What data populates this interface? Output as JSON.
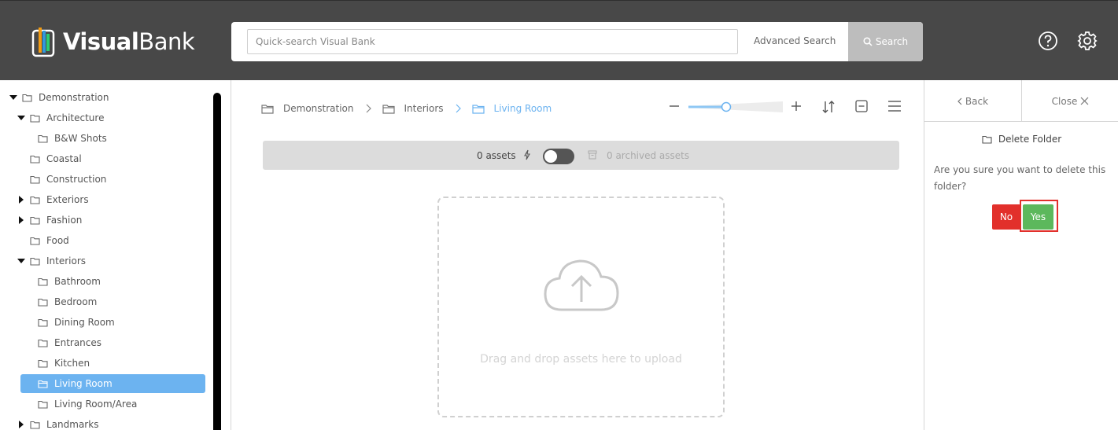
{
  "header": {
    "logo_text_bold": "Visual",
    "logo_text_light": "Bank",
    "search_placeholder": "Quick-search Visual Bank",
    "advanced_search": "Advanced Search",
    "search_button": "Search"
  },
  "tree": {
    "items": [
      {
        "label": "Demonstration",
        "expanded": true
      },
      {
        "label": "Architecture",
        "expanded": true
      },
      {
        "label": "B&W Shots"
      },
      {
        "label": "Coastal"
      },
      {
        "label": "Construction"
      },
      {
        "label": "Exteriors",
        "expanded": false
      },
      {
        "label": "Fashion",
        "expanded": false
      },
      {
        "label": "Food"
      },
      {
        "label": "Interiors",
        "expanded": true
      },
      {
        "label": "Bathroom"
      },
      {
        "label": "Bedroom"
      },
      {
        "label": "Dining Room"
      },
      {
        "label": "Entrances"
      },
      {
        "label": "Kitchen"
      },
      {
        "label": "Living Room",
        "selected": true
      },
      {
        "label": "Living Room/Area"
      },
      {
        "label": "Landmarks",
        "expanded": false
      }
    ]
  },
  "breadcrumb": {
    "items": [
      "Demonstration",
      "Interiors",
      "Living Room"
    ]
  },
  "toolbar": {
    "zoom_level": 0.4
  },
  "assets_bar": {
    "count": "0 assets",
    "archived": "0 archived assets"
  },
  "dropzone": {
    "text": "Drag and drop assets here to upload"
  },
  "panel": {
    "back": "Back",
    "close": "Close",
    "title": "Delete Folder",
    "confirm": "Are you sure you want to delete this folder?",
    "no": "No",
    "yes": "Yes"
  },
  "colors": {
    "header_bg": "#484848",
    "accent_blue": "#6cb3f0",
    "danger_red": "#e2302b",
    "success_green": "#5cb85c"
  }
}
